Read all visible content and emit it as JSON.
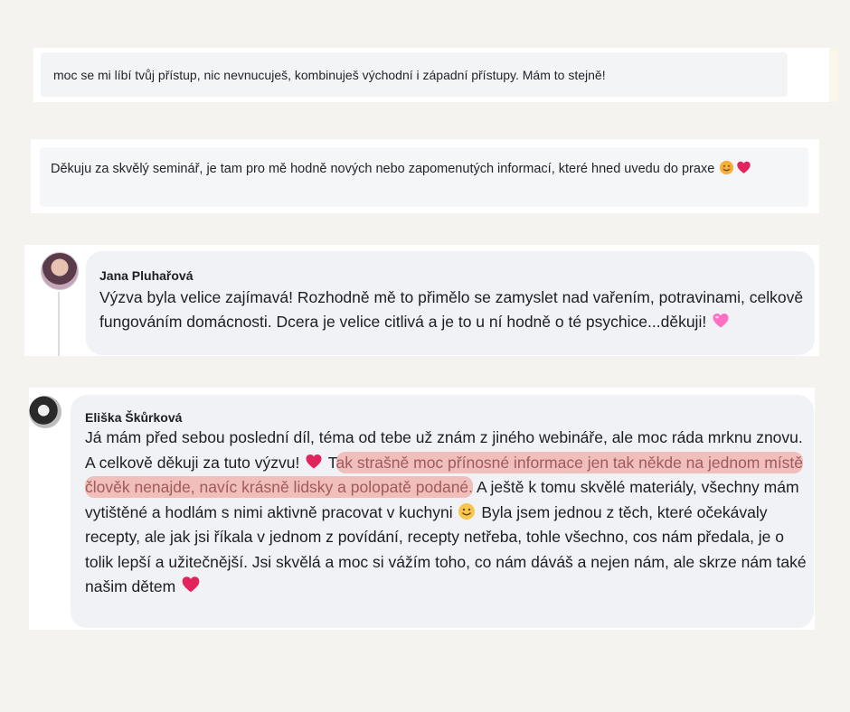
{
  "comments": [
    {
      "text": "moc se mi líbí tvůj přístup, nic nevnucuješ, kombinuješ východní i západní přístupy. Mám to stejně!"
    },
    {
      "text": "Děkuju za skvělý seminář, je tam pro mě hodně nových nebo zapomenutých informací, které hned uvedu do praxe"
    },
    {
      "author": "Jana Pluhařová",
      "text": "Výzva byla velice zajímavá! Rozhodně mě to přimělo se zamyslet nad vařením, potravinami, celkově fungováním domácnosti. Dcera je velice citlivá a je to u ní hodně o té psychice...děkuji!"
    },
    {
      "author": "Eliška Škůrková",
      "text_part1": "Já mám před sebou poslední díl, téma od tebe už znám z jiného webináře, ale moc ráda mrknu znovu. A celkově děkuji za tuto výzvu!",
      "text_pre_highlight": "T",
      "text_highlight": "ak strašně moc přínosné informace jen tak někde na jednom místě člověk nenajde, navíc krásně lidsky a polopatě podané.",
      "text_part2": "A ještě k tomu skvělé materiály, všechny mám vytištěné a hodlám s nimi aktivně pracovat v kuchyni",
      "text_part3": "Byla jsem jednou z těch, které očekávaly recepty, ale jak jsi říkala v jednom z povídání, recepty netřeba, tohle všechno, cos nám předala, je o tolik lepší a užitečnější. Jsi skvělá a moc si vážím toho, co nám dáváš a nejen nám, ale skrze nám také našim dětem"
    }
  ],
  "icons": {
    "smile": "smiling-face-emoji",
    "heart": "red-heart-emoji",
    "pink_heart": "pink-heart-emoji"
  },
  "colors": {
    "page_bg": "#f5f3ef",
    "bubble_bg": "#f0f2f5",
    "highlight": "#f0968c",
    "heart_red": "#e0245e",
    "heart_pink": "#ff6fc2"
  }
}
